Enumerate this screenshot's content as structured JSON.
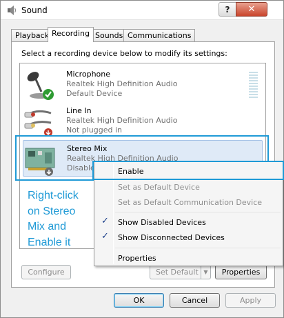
{
  "window": {
    "title": "Sound",
    "help_glyph": "?",
    "close_glyph": "✕"
  },
  "tabs": [
    {
      "label": "Playback"
    },
    {
      "label": "Recording"
    },
    {
      "label": "Sounds"
    },
    {
      "label": "Communications"
    }
  ],
  "instruction": "Select a recording device below to modify its settings:",
  "devices": [
    {
      "name": "Microphone",
      "driver": "Realtek High Definition Audio",
      "status": "Default Device",
      "icon": "microphone-icon"
    },
    {
      "name": "Line In",
      "driver": "Realtek High Definition Audio",
      "status": "Not plugged in",
      "icon": "line-in-icon"
    },
    {
      "name": "Stereo Mix",
      "driver": "Realtek High Definition Audio",
      "status": "Disabled",
      "icon": "sound-card-icon"
    }
  ],
  "context_menu": {
    "items": [
      {
        "label": "Enable",
        "enabled": true,
        "checked": false
      },
      {
        "label": "Set as Default Device",
        "enabled": false,
        "checked": false
      },
      {
        "label": "Set as Default Communication Device",
        "enabled": false,
        "checked": false
      },
      {
        "label": "Show Disabled Devices",
        "enabled": true,
        "checked": true
      },
      {
        "label": "Show Disconnected Devices",
        "enabled": true,
        "checked": true
      },
      {
        "label": "Properties",
        "enabled": true,
        "checked": false
      }
    ]
  },
  "annotation": {
    "text": "Right-click on Stereo Mix and Enable it"
  },
  "panel_buttons": {
    "configure": "Configure",
    "set_default": "Set Default",
    "properties": "Properties"
  },
  "dialog_buttons": {
    "ok": "OK",
    "cancel": "Cancel",
    "apply": "Apply"
  },
  "colors": {
    "highlight": "#1f9ad6",
    "check": "#1c3f8a",
    "disabled_text": "#8d8d8d"
  }
}
